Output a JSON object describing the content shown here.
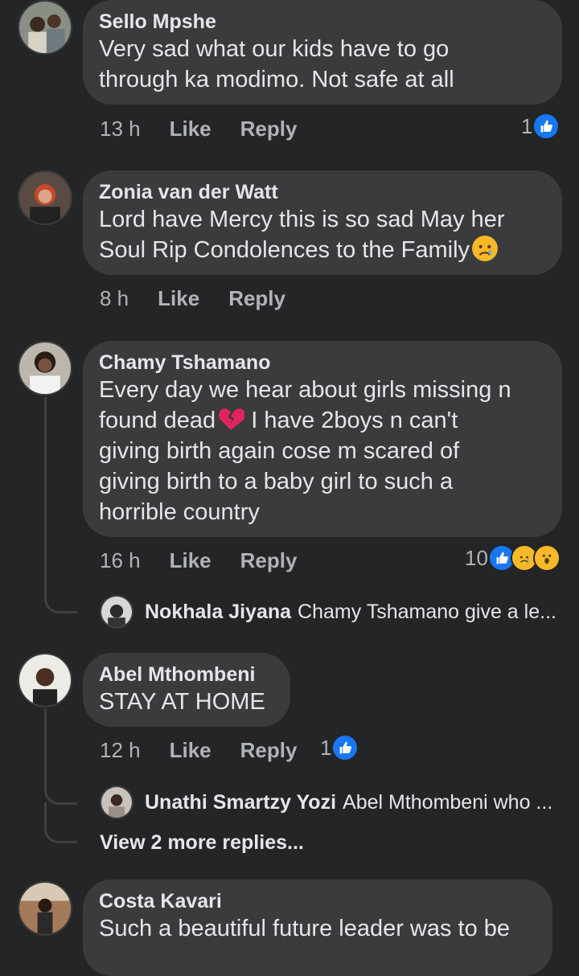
{
  "colors": {
    "background": "#242526",
    "bubble": "#3a3b3c",
    "text": "#e4e6eb",
    "secondary_text": "#b0b3b8",
    "like_blue": "#1877f2",
    "emoji_yellow": "#f7b928"
  },
  "comments": [
    {
      "author": "Sello Mpshe",
      "text": "Very sad what our kids have to go\nthrough ka modimo. Not safe at all",
      "time": "13 h",
      "like_label": "Like",
      "reply_label": "Reply",
      "reaction_count": "1",
      "reactions": [
        "like-icon"
      ]
    },
    {
      "author": "Zonia van der Watt",
      "text": "Lord have Mercy this is so sad May her\nSoul Rip Condolences to the Family",
      "emoji": "crying-face-emoji",
      "time": "8 h",
      "like_label": "Like",
      "reply_label": "Reply"
    },
    {
      "author": "Chamy Tshamano",
      "text_part1": "Every day we hear about girls missing n\nfound dead",
      "emoji": "broken-heart-emoji",
      "text_part2": " I have 2boys n can't\ngiving birth again cose m scared of\ngiving birth to a baby girl to such a\nhorrible country",
      "time": "16 h",
      "like_label": "Like",
      "reply_label": "Reply",
      "reaction_count": "10",
      "reactions": [
        "like-icon",
        "sad-icon",
        "wow-icon"
      ],
      "reply": {
        "author": "Nokhala Jiyana",
        "text": "Chamy Tshamano give a le..."
      }
    },
    {
      "author": "Abel Mthombeni",
      "text": "STAY AT HOME",
      "time": "12 h",
      "like_label": "Like",
      "reply_label": "Reply",
      "reaction_count": "1",
      "reactions": [
        "like-icon"
      ],
      "reply": {
        "author": "Unathi Smartzy Yozi",
        "text": "Abel Mthombeni who ..."
      },
      "more_replies": "View 2 more replies..."
    },
    {
      "author": "Costa Kavari",
      "text": "Such a beautiful future leader was to be"
    }
  ]
}
